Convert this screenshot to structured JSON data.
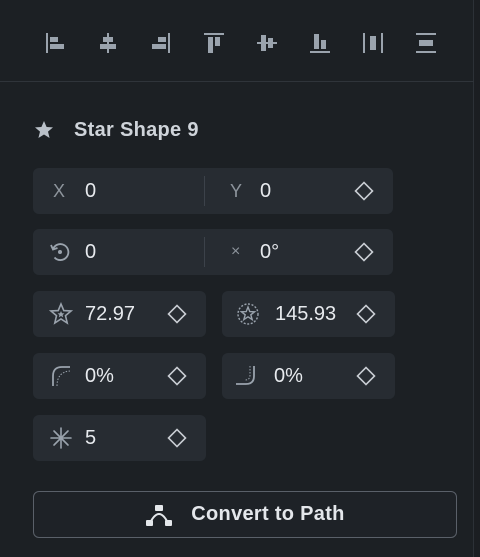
{
  "align_toolbar": {
    "buttons": [
      {
        "name": "align-left-icon"
      },
      {
        "name": "align-center-horizontal-icon"
      },
      {
        "name": "align-right-icon"
      },
      {
        "name": "align-top-icon"
      },
      {
        "name": "align-center-vertical-icon"
      },
      {
        "name": "align-bottom-icon"
      },
      {
        "name": "distribute-horizontal-icon"
      },
      {
        "name": "distribute-vertical-icon"
      }
    ]
  },
  "layer": {
    "icon": "star-icon",
    "title": "Star Shape 9"
  },
  "position": {
    "x_label": "X",
    "x_value": "0",
    "y_label": "Y",
    "y_value": "0"
  },
  "rotation": {
    "icon": "rotate-icon",
    "value": "0",
    "skew_label": "×",
    "skew_value": "0°"
  },
  "star": {
    "inner_radius_icon": "star-inner-radius-icon",
    "inner_radius": "72.97",
    "outer_radius_icon": "star-outer-radius-icon",
    "outer_radius": "145.93",
    "inner_roundness_icon": "inner-roundness-icon",
    "inner_roundness": "0%",
    "outer_roundness_icon": "outer-roundness-icon",
    "outer_roundness": "0%",
    "points_icon": "star-points-icon",
    "points": "5"
  },
  "actions": {
    "convert_icon": "bezier-path-icon",
    "convert_label": "Convert to Path"
  },
  "colors": {
    "background": "#1c2024",
    "field": "#272c32",
    "icon": "#9aa3ad",
    "text": "#e7eaee"
  }
}
